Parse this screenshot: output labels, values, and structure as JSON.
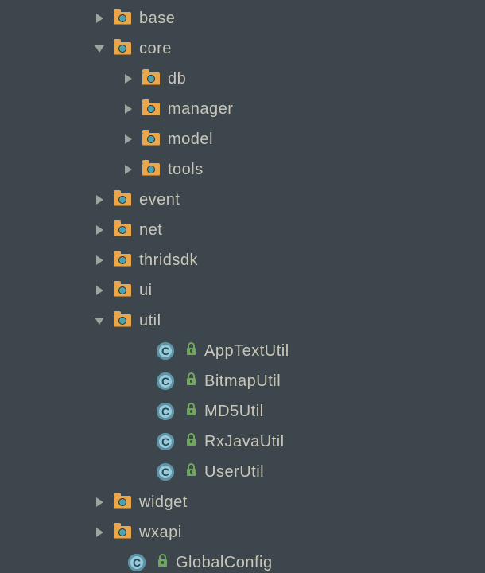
{
  "indentBase": 115,
  "indentStep": 36,
  "rows": [
    {
      "level": 0,
      "kind": "folder",
      "expanded": false,
      "key": "base",
      "label": "base"
    },
    {
      "level": 0,
      "kind": "folder",
      "expanded": true,
      "key": "core",
      "label": "core"
    },
    {
      "level": 1,
      "kind": "folder",
      "expanded": false,
      "key": "db",
      "label": "db"
    },
    {
      "level": 1,
      "kind": "folder",
      "expanded": false,
      "key": "manager",
      "label": "manager"
    },
    {
      "level": 1,
      "kind": "folder",
      "expanded": false,
      "key": "model",
      "label": "model"
    },
    {
      "level": 1,
      "kind": "folder",
      "expanded": false,
      "key": "tools",
      "label": "tools"
    },
    {
      "level": 0,
      "kind": "folder",
      "expanded": false,
      "key": "event",
      "label": "event"
    },
    {
      "level": 0,
      "kind": "folder",
      "expanded": false,
      "key": "net",
      "label": "net"
    },
    {
      "level": 0,
      "kind": "folder",
      "expanded": false,
      "key": "thridsdk",
      "label": "thridsdk"
    },
    {
      "level": 0,
      "kind": "folder",
      "expanded": false,
      "key": "ui",
      "label": "ui"
    },
    {
      "level": 0,
      "kind": "folder",
      "expanded": true,
      "key": "util",
      "label": "util"
    },
    {
      "level": 1,
      "kind": "class",
      "key": "apptextutil",
      "label": "AppTextUtil"
    },
    {
      "level": 1,
      "kind": "class",
      "key": "bitmaputil",
      "label": "BitmapUtil"
    },
    {
      "level": 1,
      "kind": "class",
      "key": "md5util",
      "label": "MD5Util"
    },
    {
      "level": 1,
      "kind": "class",
      "key": "rxjavautil",
      "label": "RxJavaUtil"
    },
    {
      "level": 1,
      "kind": "class",
      "key": "userutil",
      "label": "UserUtil"
    },
    {
      "level": 0,
      "kind": "folder",
      "expanded": false,
      "key": "widget",
      "label": "widget"
    },
    {
      "level": 0,
      "kind": "folder",
      "expanded": false,
      "key": "wxapi",
      "label": "wxapi"
    },
    {
      "level": 0,
      "kind": "class",
      "key": "globalconfig",
      "label": "GlobalConfig"
    }
  ],
  "classBadgeLetter": "C",
  "icons": {
    "collapsed": "chevron-right-icon",
    "expanded": "chevron-down-icon",
    "folder": "package-folder-icon",
    "class": "java-class-icon",
    "lock": "unlocked-public-icon"
  }
}
